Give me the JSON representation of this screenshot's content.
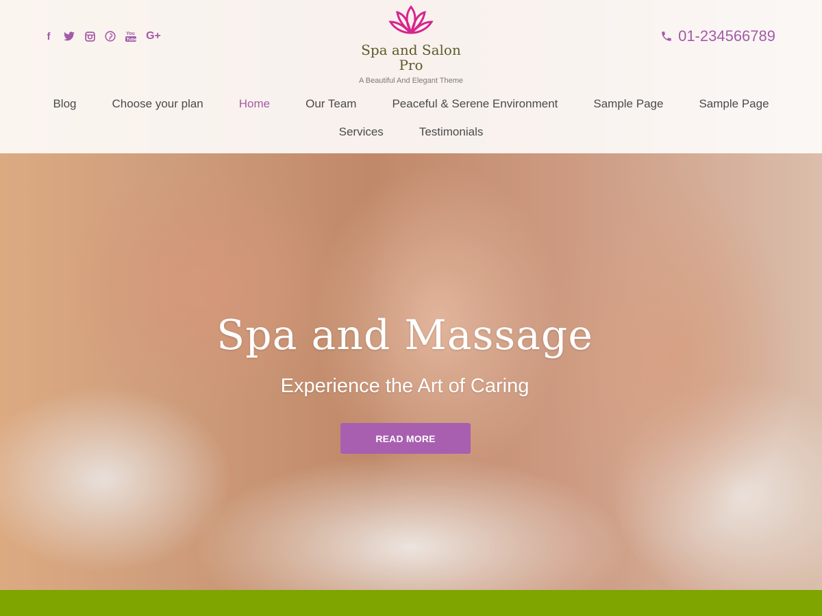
{
  "colors": {
    "accent_purple": "#a35aa8",
    "button_purple": "#a85fb0",
    "logo_pink": "#d6248f",
    "brand_text": "#5c5a2a",
    "footer_green": "#7ea500"
  },
  "header": {
    "socials": [
      {
        "name": "facebook-icon",
        "glyph": "f"
      },
      {
        "name": "twitter-icon",
        "glyph": ""
      },
      {
        "name": "instagram-icon",
        "glyph": ""
      },
      {
        "name": "pinterest-icon",
        "glyph": ""
      },
      {
        "name": "youtube-icon",
        "glyph": ""
      },
      {
        "name": "google-plus-icon",
        "glyph": "G+"
      }
    ],
    "logo": {
      "icon": "lotus-icon",
      "name": "Spa and Salon Pro",
      "tagline": "A Beautiful And Elegant Theme"
    },
    "phone": {
      "icon": "phone-icon",
      "number": "01-234566789"
    }
  },
  "nav": {
    "row1": [
      "Blog",
      "Choose your plan",
      "Home",
      "Our Team",
      "Peaceful & Serene Environment",
      "Sample Page",
      "Sample Page"
    ],
    "row2": [
      "Services",
      "Testimonials"
    ],
    "active": "Home"
  },
  "hero": {
    "title": "Spa and Massage",
    "subtitle": "Experience the Art of Caring",
    "button_label": "READ MORE"
  }
}
